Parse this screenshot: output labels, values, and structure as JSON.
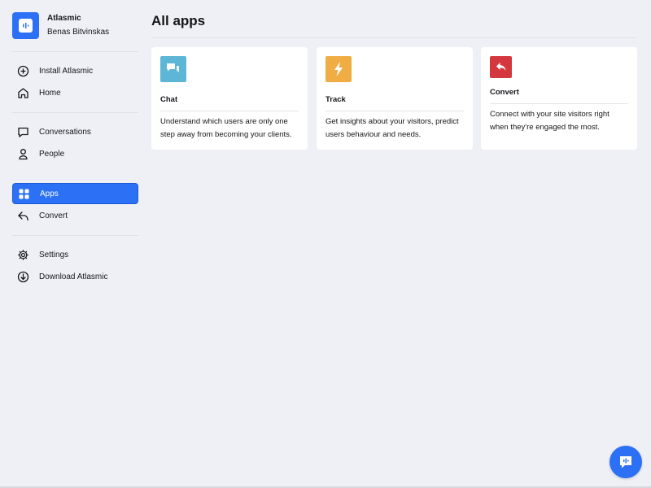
{
  "brand": {
    "name": "Atlasmic",
    "user": "Benas Bitvinskas",
    "icon": "atlasmic-logo-icon",
    "color": "#2b70f5"
  },
  "sidebar": {
    "items": [
      {
        "label": "Install Atlasmic",
        "icon": "plus-circle-icon"
      },
      {
        "label": "Home",
        "icon": "home-icon"
      },
      {
        "label": "Conversations",
        "icon": "chat-bubble-icon"
      },
      {
        "label": "People",
        "icon": "person-icon"
      },
      {
        "label": "Apps",
        "icon": "grid-icon",
        "active": true
      },
      {
        "label": "Convert",
        "icon": "reply-arrow-icon"
      },
      {
        "label": "Settings",
        "icon": "gear-icon"
      },
      {
        "label": "Download Atlasmic",
        "icon": "download-circle-icon"
      }
    ]
  },
  "main": {
    "title": "All apps",
    "cards": [
      {
        "name": "Chat",
        "description": "Understand which users are only one step away from becoming your clients.",
        "icon": "chat-app-icon",
        "color": "#5eb6d6"
      },
      {
        "name": "Track",
        "description": "Get insights about your visitors, predict users behaviour and needs.",
        "icon": "lightning-icon",
        "color": "#f0ad44"
      },
      {
        "name": "Convert",
        "description": "Connect with your site visitors right when they're engaged the most.",
        "icon": "convert-reply-icon",
        "color": "#d5373f"
      }
    ]
  },
  "chat_widget": {
    "icon": "chat-widget-icon",
    "color": "#2b70f5"
  }
}
